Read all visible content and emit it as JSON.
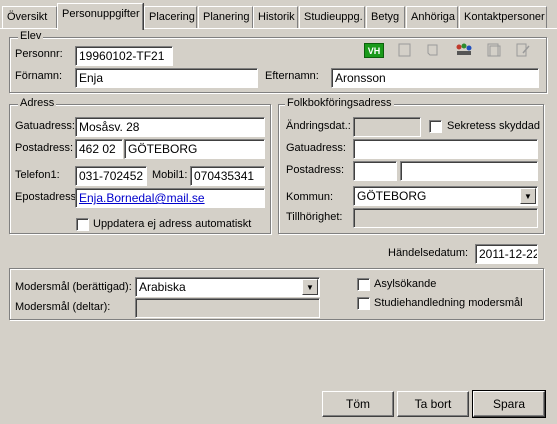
{
  "tabs": [
    "Översikt",
    "Personuppgifter",
    "Placering",
    "Planering",
    "Historik",
    "Studieuppg.",
    "Betyg",
    "Anhöriga",
    "Kontaktpersoner"
  ],
  "elev": {
    "legend": "Elev",
    "personnr_label": "Personnr:",
    "personnr": "19960102-TF21",
    "fornamn_label": "Förnamn:",
    "fornamn": "Enja",
    "efternamn_label": "Efternamn:",
    "efternamn": "Aronsson",
    "vh_badge": "VH"
  },
  "adress": {
    "legend": "Adress",
    "gatuadress_label": "Gatuadress:",
    "gatuadress": "Mosåsv. 28",
    "postadress_label": "Postadress:",
    "postnr": "462 02",
    "ort": "GÖTEBORG",
    "telefon1_label": "Telefon1:",
    "telefon1": "031-702452",
    "mobil1_label": "Mobil1:",
    "mobil1": "070435341",
    "epost_label": "Epostadress:",
    "epost": "Enja.Bornedal@mail.se",
    "auto_update_label": "Uppdatera ej adress automatiskt"
  },
  "folkbokforing": {
    "legend": "Folkbokföringsadress",
    "andringsdat_label": "Ändringsdat.:",
    "sekretess_label": "Sekretess skyddad",
    "gatuadress_label": "Gatuadress:",
    "postadress_label": "Postadress:",
    "kommun_label": "Kommun:",
    "kommun": "GÖTEBORG",
    "tillhorighet_label": "Tillhörighet:"
  },
  "handelsedatum": {
    "label": "Händelsedatum:",
    "value": "2011-12-22"
  },
  "modersmal": {
    "berattigad_label": "Modersmål (berättigad):",
    "berattigad_value": "Arabiska",
    "deltar_label": "Modersmål (deltar):",
    "asylsokande_label": "Asylsökande",
    "studiehandledning_label": "Studiehandledning modersmål"
  },
  "buttons": {
    "tom": "Töm",
    "ta_bort": "Ta bort",
    "spara": "Spara"
  }
}
